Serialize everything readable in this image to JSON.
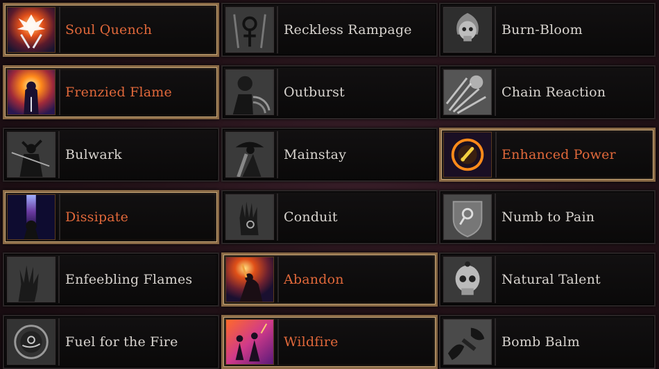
{
  "colors": {
    "selected_label": "#e0683a",
    "normal_label": "#d8d4cf",
    "selected_border": "#8a6a46"
  },
  "skills": [
    {
      "label": "Soul Quench",
      "selected": true,
      "icon": "phoenix-swords-icon"
    },
    {
      "label": "Reckless Rampage",
      "selected": false,
      "icon": "ankh-blades-icon"
    },
    {
      "label": "Burn-Bloom",
      "selected": false,
      "icon": "flaming-skull-icon"
    },
    {
      "label": "Frenzied Flame",
      "selected": true,
      "icon": "burning-figure-icon"
    },
    {
      "label": "Outburst",
      "selected": false,
      "icon": "shouting-demon-icon"
    },
    {
      "label": "Chain Reaction",
      "selected": false,
      "icon": "explosion-burst-icon"
    },
    {
      "label": "Bulwark",
      "selected": false,
      "icon": "horned-warrior-icon"
    },
    {
      "label": "Mainstay",
      "selected": false,
      "icon": "hatted-staff-icon"
    },
    {
      "label": "Enhanced Power",
      "selected": true,
      "icon": "glowing-orb-icon"
    },
    {
      "label": "Dissipate",
      "selected": true,
      "icon": "spirit-column-icon"
    },
    {
      "label": "Conduit",
      "selected": false,
      "icon": "open-hand-icon"
    },
    {
      "label": "Numb to Pain",
      "selected": false,
      "icon": "shield-sigil-icon"
    },
    {
      "label": "Enfeebling Flames",
      "selected": false,
      "icon": "clawed-hand-icon"
    },
    {
      "label": "Abandon",
      "selected": true,
      "icon": "torch-bearer-icon"
    },
    {
      "label": "Natural Talent",
      "selected": false,
      "icon": "locked-skull-icon"
    },
    {
      "label": "Fuel for the Fire",
      "selected": false,
      "icon": "ring-sigil-icon"
    },
    {
      "label": "Wildfire",
      "selected": true,
      "icon": "dancing-figures-icon"
    },
    {
      "label": "Bomb Balm",
      "selected": false,
      "icon": "silhouette-hands-icon"
    }
  ]
}
